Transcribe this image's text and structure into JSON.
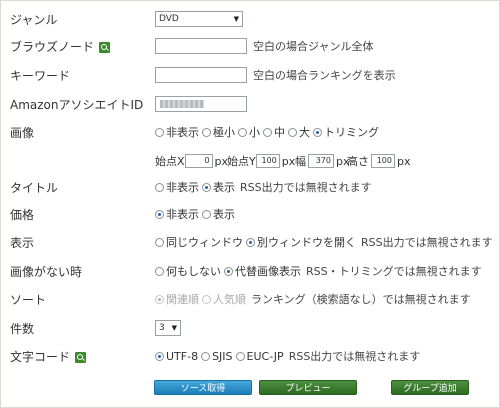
{
  "genre": {
    "label": "ジャンル",
    "value": "DVD"
  },
  "browse_node": {
    "label": "ブラウズノード",
    "hint": "空白の場合ジャンル全体"
  },
  "keyword": {
    "label": "キーワード",
    "hint": "空白の場合ランキングを表示"
  },
  "associate_id": {
    "label": "AmazonアソシエイトID"
  },
  "image": {
    "label": "画像",
    "options": [
      "非表示",
      "極小",
      "小",
      "中",
      "大",
      "トリミング"
    ],
    "selected": "トリミング"
  },
  "trim": {
    "start_x_label": "始点X",
    "start_x_value": "0",
    "start_x_unit": "px",
    "start_y_label": "始点Y",
    "start_y_value": "100",
    "start_y_unit": "px",
    "width_label": "幅",
    "width_value": "370",
    "width_unit": "px",
    "height_label": "高さ",
    "height_value": "100",
    "height_unit": "px"
  },
  "title": {
    "label": "タイトル",
    "options": [
      "非表示",
      "表示"
    ],
    "selected": "表示",
    "hint": "RSS出力では無視されます"
  },
  "price": {
    "label": "価格",
    "options": [
      "非表示",
      "表示"
    ],
    "selected": "非表示"
  },
  "display": {
    "label": "表示",
    "options": [
      "同じウィンドウ",
      "別ウィンドウを開く"
    ],
    "selected": "別ウィンドウを開く",
    "hint": "RSS出力では無視されます"
  },
  "no_image": {
    "label": "画像がない時",
    "options": [
      "何もしない",
      "代替画像表示"
    ],
    "selected": "代替画像表示",
    "hint": "RSS・トリミングでは無視されます"
  },
  "sort": {
    "label": "ソート",
    "options": [
      "関連順",
      "人気順"
    ],
    "selected": "関連順",
    "hint": "ランキング（検索語なし）では無視されます"
  },
  "count": {
    "label": "件数",
    "value": "3"
  },
  "charset": {
    "label": "文字コード",
    "options": [
      "UTF-8",
      "SJIS",
      "EUC-JP"
    ],
    "selected": "UTF-8",
    "hint": "RSS出力では無視されます"
  },
  "buttons": {
    "get_source": "ソース取得",
    "preview": "プレビュー",
    "add_group": "グループ追加"
  }
}
